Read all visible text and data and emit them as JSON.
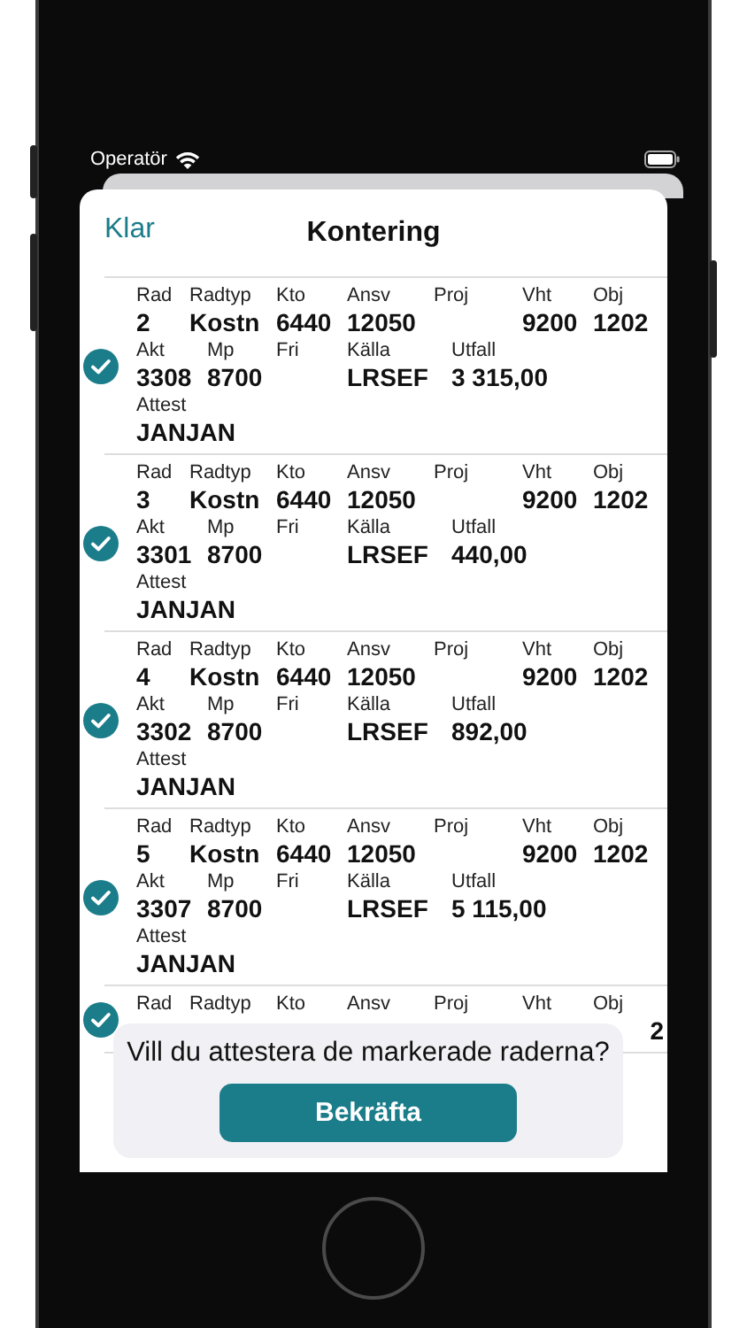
{
  "status_bar": {
    "carrier": "Operatör"
  },
  "header": {
    "done": "Klar",
    "title": "Kontering"
  },
  "rows": [
    {
      "checked": true,
      "line1": [
        {
          "label": "Rad",
          "value": "2"
        },
        {
          "label": "Radtyp",
          "value": "Kostn"
        },
        {
          "label": "Kto",
          "value": "6440"
        },
        {
          "label": "Ansv",
          "value": "12050"
        },
        {
          "label": "Proj"
        },
        {
          "label": "Vht",
          "value": "9200"
        },
        {
          "label": "Obj",
          "value": "1202"
        }
      ],
      "line2": [
        {
          "label": "Akt",
          "value": "3308"
        },
        {
          "label": "Mp",
          "value": "8700"
        },
        {
          "label": "Fri"
        },
        {
          "label": "Källa",
          "value": "LRSEF"
        },
        {
          "label": "Utfall",
          "value": "3 315,00"
        }
      ],
      "line3": [
        {
          "label": "Attest",
          "value": "JANJAN"
        }
      ]
    },
    {
      "checked": true,
      "line1": [
        {
          "label": "Rad",
          "value": "3"
        },
        {
          "label": "Radtyp",
          "value": "Kostn"
        },
        {
          "label": "Kto",
          "value": "6440"
        },
        {
          "label": "Ansv",
          "value": "12050"
        },
        {
          "label": "Proj"
        },
        {
          "label": "Vht",
          "value": "9200"
        },
        {
          "label": "Obj",
          "value": "1202"
        }
      ],
      "line2": [
        {
          "label": "Akt",
          "value": "3301"
        },
        {
          "label": "Mp",
          "value": "8700"
        },
        {
          "label": "Fri"
        },
        {
          "label": "Källa",
          "value": "LRSEF"
        },
        {
          "label": "Utfall",
          "value": "440,00"
        }
      ],
      "line3": [
        {
          "label": "Attest",
          "value": "JANJAN"
        }
      ]
    },
    {
      "checked": true,
      "line1": [
        {
          "label": "Rad",
          "value": "4"
        },
        {
          "label": "Radtyp",
          "value": "Kostn"
        },
        {
          "label": "Kto",
          "value": "6440"
        },
        {
          "label": "Ansv",
          "value": "12050"
        },
        {
          "label": "Proj"
        },
        {
          "label": "Vht",
          "value": "9200"
        },
        {
          "label": "Obj",
          "value": "1202"
        }
      ],
      "line2": [
        {
          "label": "Akt",
          "value": "3302"
        },
        {
          "label": "Mp",
          "value": "8700"
        },
        {
          "label": "Fri"
        },
        {
          "label": "Källa",
          "value": "LRSEF"
        },
        {
          "label": "Utfall",
          "value": "892,00"
        }
      ],
      "line3": [
        {
          "label": "Attest",
          "value": "JANJAN"
        }
      ]
    },
    {
      "checked": true,
      "line1": [
        {
          "label": "Rad",
          "value": "5"
        },
        {
          "label": "Radtyp",
          "value": "Kostn"
        },
        {
          "label": "Kto",
          "value": "6440"
        },
        {
          "label": "Ansv",
          "value": "12050"
        },
        {
          "label": "Proj"
        },
        {
          "label": "Vht",
          "value": "9200"
        },
        {
          "label": "Obj",
          "value": "1202"
        }
      ],
      "line2": [
        {
          "label": "Akt",
          "value": "3307"
        },
        {
          "label": "Mp",
          "value": "8700"
        },
        {
          "label": "Fri"
        },
        {
          "label": "Källa",
          "value": "LRSEF"
        },
        {
          "label": "Utfall",
          "value": "5 115,00"
        }
      ],
      "line3": [
        {
          "label": "Attest",
          "value": "JANJAN"
        }
      ]
    },
    {
      "checked": true,
      "line1": [
        {
          "label": "Rad"
        },
        {
          "label": "Radtyp"
        },
        {
          "label": "Kto"
        },
        {
          "label": "Ansv"
        },
        {
          "label": "Proj"
        },
        {
          "label": "Vht"
        },
        {
          "label": "Obj",
          "value": "2"
        }
      ]
    }
  ],
  "prompt": {
    "text": "Vill du attestera de markerade raderna?",
    "button": "Bekräfta"
  }
}
